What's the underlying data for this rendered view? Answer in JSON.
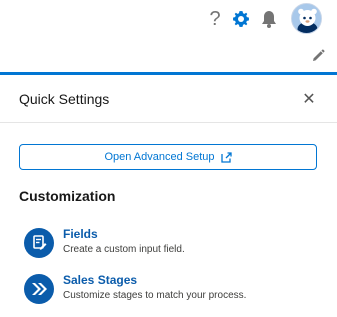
{
  "colors": {
    "brand_blue": "#0176d3",
    "dark_blue": "#0b5cab",
    "icon_gray": "#747474"
  },
  "header": {
    "help_icon": "?",
    "icons": [
      "help-icon",
      "gear-icon",
      "bell-icon",
      "avatar"
    ]
  },
  "subbar": {
    "icons": [
      "pencil-icon"
    ]
  },
  "panel": {
    "title": "Quick Settings",
    "close_icon": "✕",
    "advanced_button": "Open Advanced Setup",
    "section_title": "Customization",
    "items": [
      {
        "title": "Fields",
        "description": "Create a custom input field.",
        "icon": "form-icon"
      },
      {
        "title": "Sales Stages",
        "description": "Customize stages to match your process.",
        "icon": "double-chevron-icon"
      }
    ]
  }
}
